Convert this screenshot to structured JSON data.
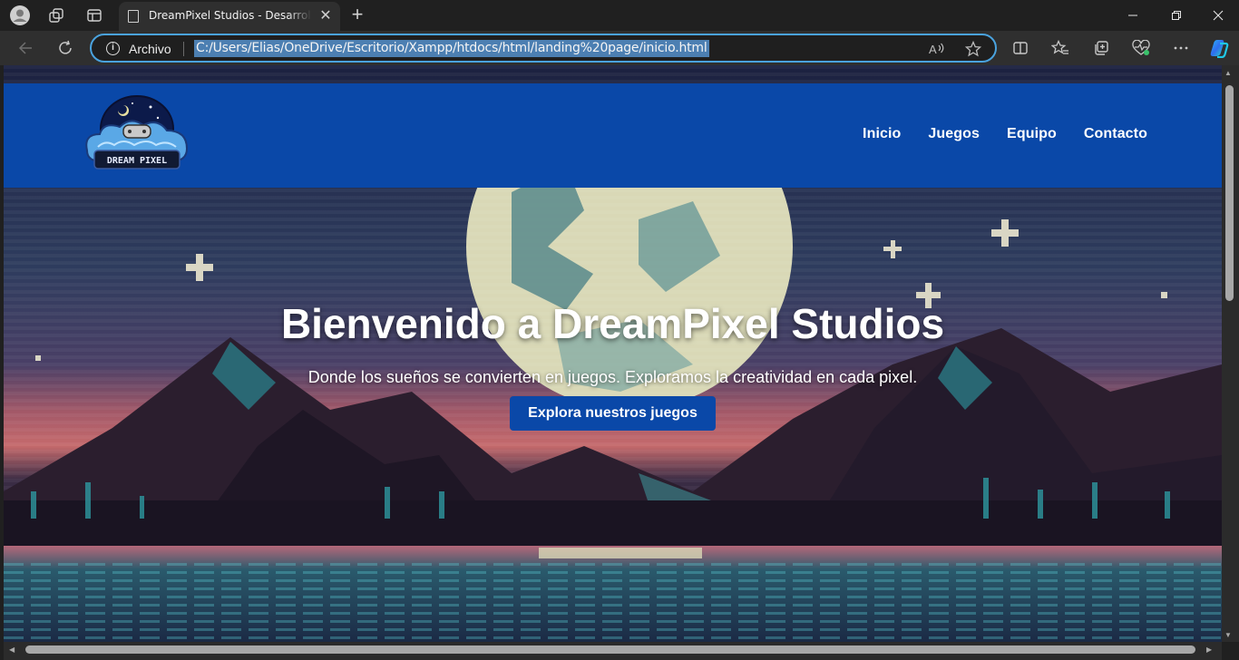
{
  "browser": {
    "tab_title": "DreamPixel Studios - Desarrollo de Videojuegos",
    "origin_label": "Archivo",
    "url": "C:/Users/Elias/OneDrive/Escritorio/Xampp/htdocs/html/landing%20page/inicio.html",
    "icons": {
      "profile": "profile-avatar-icon",
      "workspaces": "workspaces-icon",
      "tab_actions": "vertical-tabs-icon",
      "new_tab": "plus-icon",
      "back": "back-arrow-icon",
      "refresh": "refresh-icon",
      "read_aloud": "read-aloud-icon",
      "favorite": "star-icon",
      "split_screen": "split-screen-icon",
      "favorites_list": "favorites-icon",
      "collections": "collections-icon",
      "performance": "heart-pulse-icon",
      "menu": "more-dots-icon",
      "copilot": "copilot-icon"
    }
  },
  "site": {
    "logo_text": "DREAM PIXEL",
    "nav": [
      {
        "label": "Inicio"
      },
      {
        "label": "Juegos"
      },
      {
        "label": "Equipo"
      },
      {
        "label": "Contacto"
      }
    ],
    "hero": {
      "title": "Bienvenido a DreamPixel Studios",
      "subtitle": "Donde los sueños se convierten en juegos. Exploramos la creatividad en cada pixel.",
      "cta": "Explora nuestros juegos"
    },
    "colors": {
      "header": "#0a48a8",
      "button": "#0a48a8",
      "text": "#ffffff"
    }
  }
}
